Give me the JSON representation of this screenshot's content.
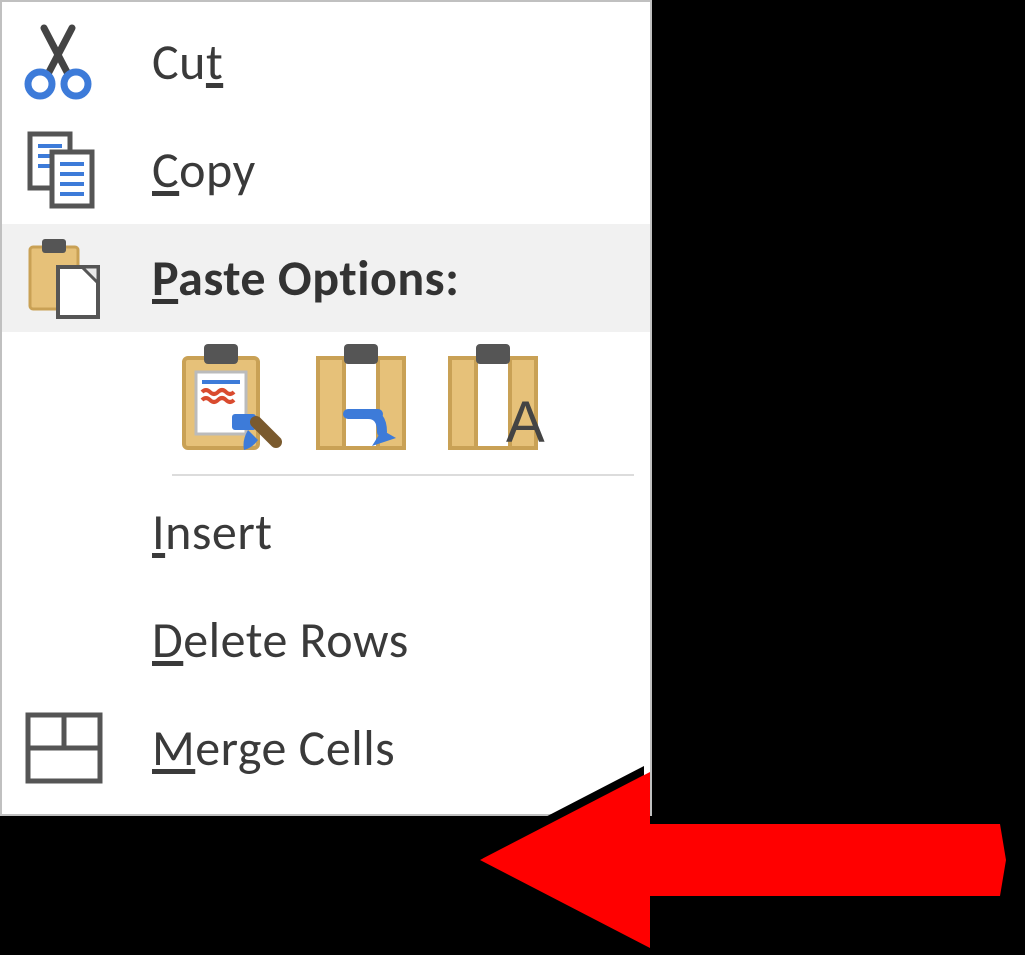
{
  "menu": {
    "cut": {
      "prefix": "Cu",
      "mnemonic": "t",
      "suffix": ""
    },
    "copy": {
      "prefix": "",
      "mnemonic": "C",
      "suffix": "opy"
    },
    "paste": {
      "prefix": "",
      "mnemonic": "P",
      "suffix": "aste Options:"
    },
    "insert": {
      "prefix": "",
      "mnemonic": "I",
      "suffix": "nsert"
    },
    "delete": {
      "prefix": "",
      "mnemonic": "D",
      "suffix": "elete Rows"
    },
    "merge": {
      "prefix": "",
      "mnemonic": "M",
      "suffix": "erge Cells"
    }
  }
}
